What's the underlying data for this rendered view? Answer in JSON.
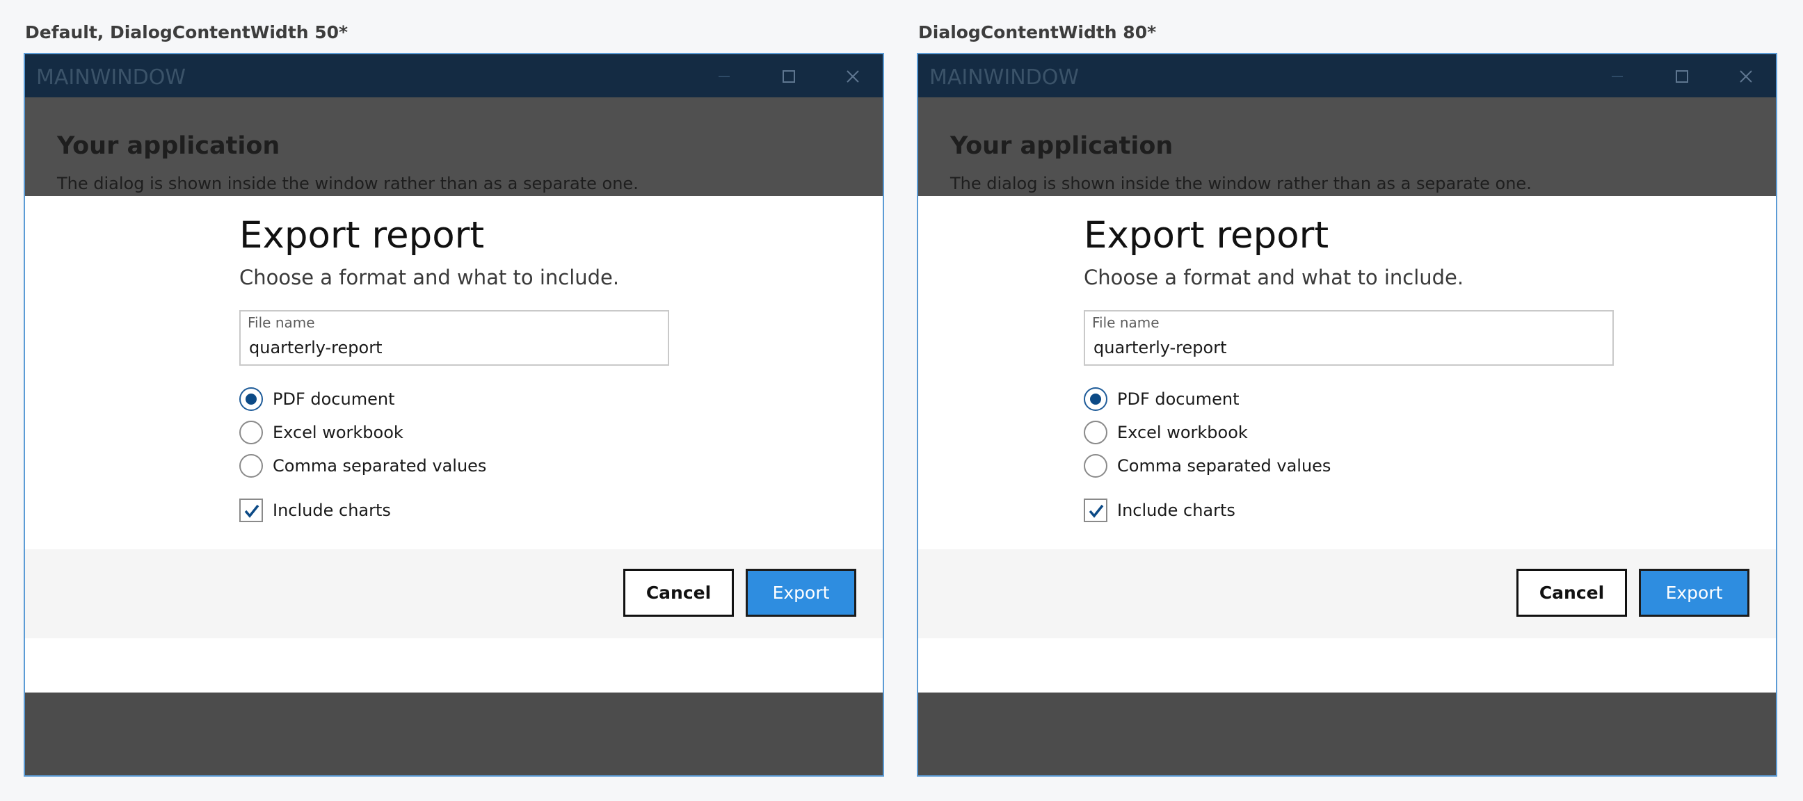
{
  "panels": [
    {
      "caption": "Default, DialogContentWidth 50*",
      "window_title": "MAINWINDOW",
      "app_heading": "Your application",
      "app_subtext": "The dialog is shown inside the window rather than as a separate one.",
      "dialog": {
        "title": "Export report",
        "subtitle": "Choose a format and what to include.",
        "file_field": {
          "label": "File name",
          "value": "quarterly-report"
        },
        "formats": [
          {
            "label": "PDF document",
            "selected": true
          },
          {
            "label": "Excel workbook",
            "selected": false
          },
          {
            "label": "Comma separated values",
            "selected": false
          }
        ],
        "include_charts": {
          "label": "Include charts",
          "checked": true
        },
        "cancel_label": "Cancel",
        "export_label": "Export"
      }
    },
    {
      "caption": "DialogContentWidth 80*",
      "window_title": "MAINWINDOW",
      "app_heading": "Your application",
      "app_subtext": "The dialog is shown inside the window rather than as a separate one.",
      "dialog": {
        "title": "Export report",
        "subtitle": "Choose a format and what to include.",
        "file_field": {
          "label": "File name",
          "value": "quarterly-report"
        },
        "formats": [
          {
            "label": "PDF document",
            "selected": true
          },
          {
            "label": "Excel workbook",
            "selected": false
          },
          {
            "label": "Comma separated values",
            "selected": false
          }
        ],
        "include_charts": {
          "label": "Include charts",
          "checked": true
        },
        "cancel_label": "Cancel",
        "export_label": "Export"
      }
    }
  ],
  "icons": {
    "minimize": "minimize-icon",
    "maximize": "maximize-icon",
    "close": "close-icon",
    "checkmark": "checkmark-icon"
  },
  "colors": {
    "titlebar": "#142b43",
    "window_border": "#5b9bd5",
    "overlay": "#4c4c4c",
    "accent_button": "#2e8de0",
    "radio_fill": "#0c4a86"
  }
}
